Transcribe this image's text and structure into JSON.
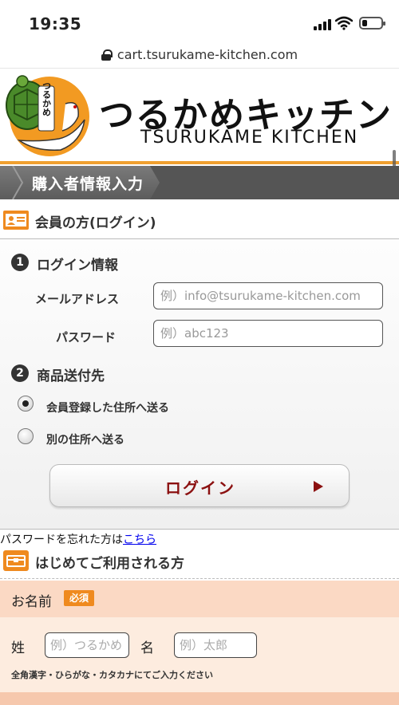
{
  "status_bar": {
    "time": "19:35",
    "battery_level": 0.25
  },
  "browser": {
    "url": "cart.tsurukame-kitchen.com"
  },
  "header": {
    "logo_title": "つるかめキッチン",
    "logo_subtitle": "TSURUKAME KITCHEN",
    "logo_badge": "つるかめ"
  },
  "page": {
    "banner_title": "購入者情報入力"
  },
  "member": {
    "heading": "会員の方(ログイン)",
    "step1_number": "1",
    "step1_label": "ログイン情報",
    "email_label": "メールアドレス",
    "email_placeholder": "例）info@tsurukame-kitchen.com",
    "password_label": "パスワード",
    "password_placeholder": "例）abc123",
    "step2_number": "2",
    "step2_label": "商品送付先",
    "radio_registered": "会員登録した住所へ送る",
    "radio_other": "別の住所へ送る",
    "login_button": "ログイン"
  },
  "forgot": {
    "text": "パスワードを忘れた方は",
    "link": "こちら"
  },
  "first_time": {
    "heading": "はじめてご利用される方",
    "name_label": "お名前",
    "required_badge": "必須",
    "last_name_label": "姓",
    "last_name_placeholder": "例）つるかめ",
    "first_name_label": "名",
    "first_name_placeholder": "例）太郎",
    "hint": "全角漢字・ひらがな・カタカナにてご入力ください"
  },
  "colors": {
    "accent": "#ef8a1f",
    "login_text": "#8b1010",
    "banner": "#555555",
    "name_row": "#fbd9c4"
  }
}
